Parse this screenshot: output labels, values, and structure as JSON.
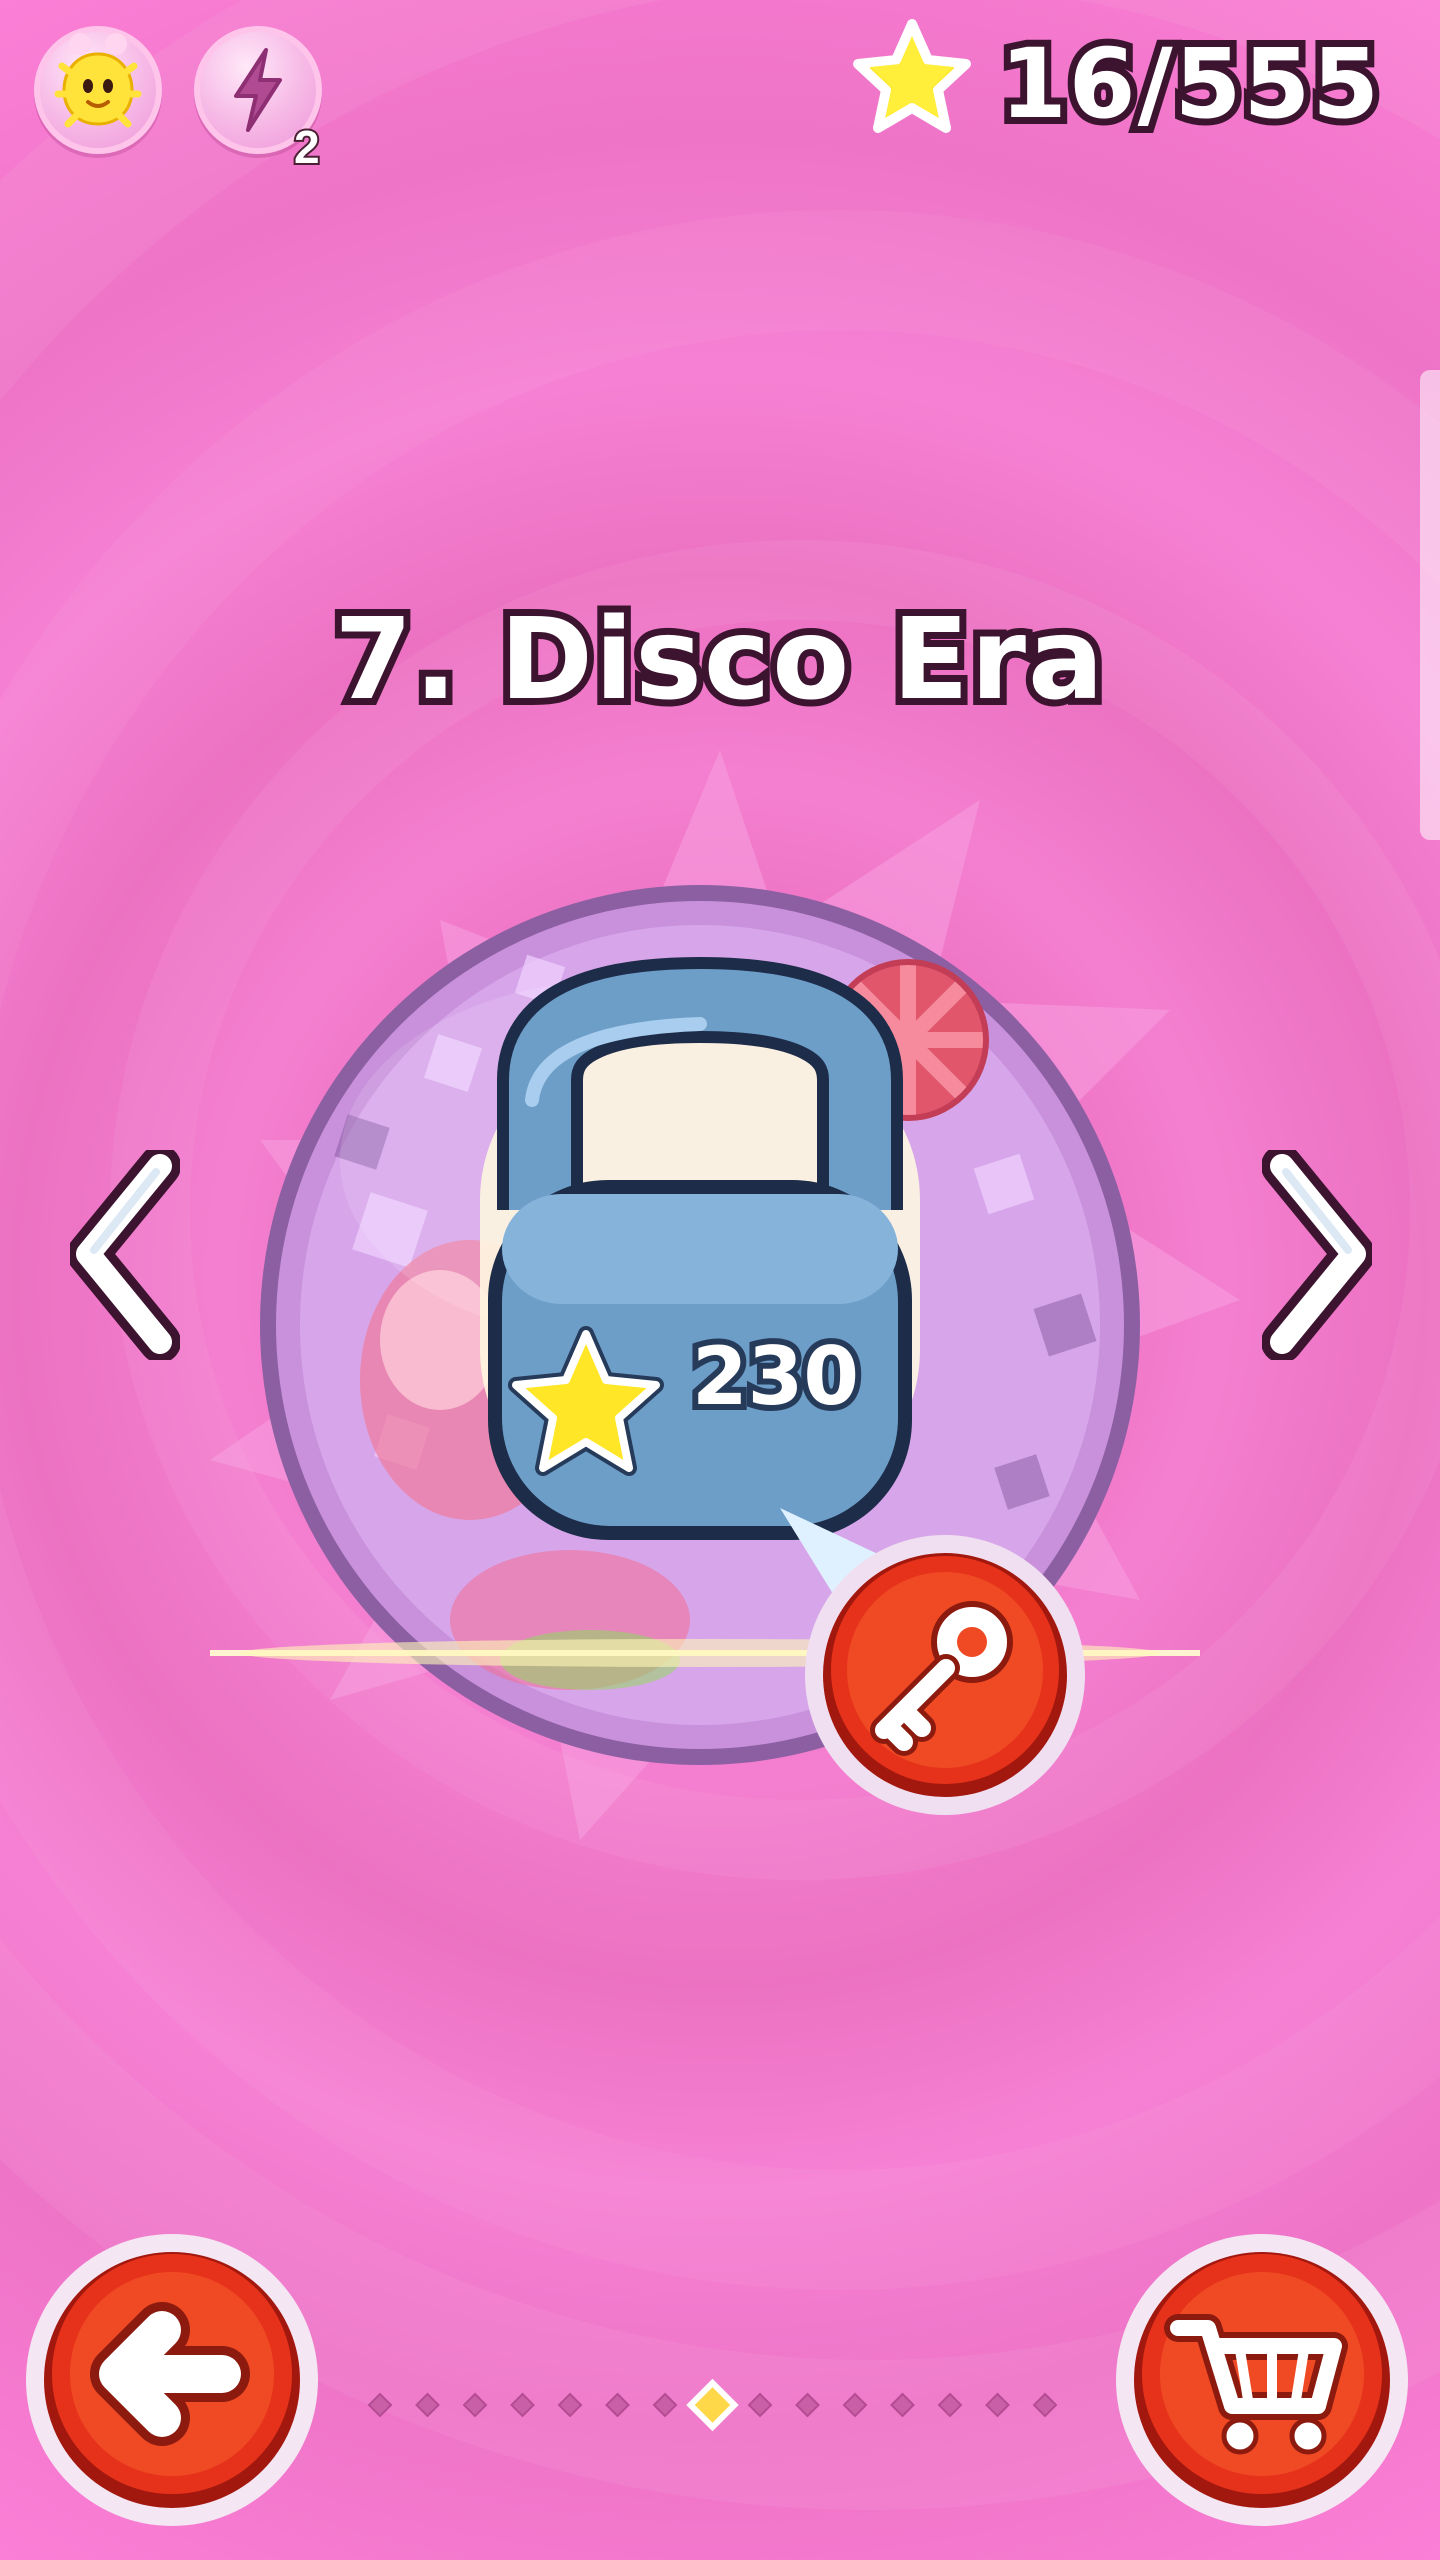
{
  "hud": {
    "energy_count": "2",
    "stars_collected": "16/555",
    "icons": [
      "avatar-icon",
      "lightning-icon",
      "star-icon"
    ]
  },
  "world": {
    "number_title": "7. Disco Era",
    "locked": true,
    "unlock_star_cost": "230"
  },
  "pager": {
    "total_pages": 15,
    "current_page": 8
  },
  "buttons": {
    "back_icon": "arrow-left-icon",
    "shop_icon": "shopping-cart-icon",
    "key_icon": "key-icon",
    "prev_icon": "chevron-left-icon",
    "next_icon": "chevron-right-icon"
  },
  "colors": {
    "background": "#f478c8",
    "button_red": "#e7321b",
    "lock_blue": "#6d9ec8",
    "star_yellow": "#ffe626"
  }
}
